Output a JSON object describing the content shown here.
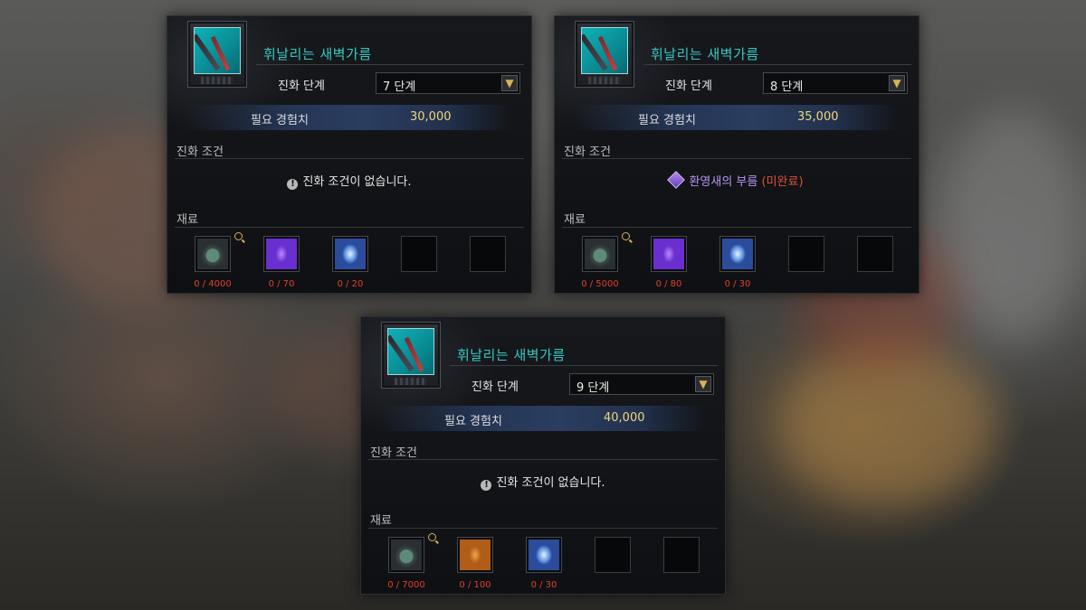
{
  "panels": [
    {
      "item_name": "휘날리는 새벽가름",
      "stage_label": "진화 단계",
      "stage_value": "7 단계",
      "exp_label": "필요 경험치",
      "exp_value": "30,000",
      "conditions_heading": "진화 조건",
      "condition_text": "진화 조건이 없습니다.",
      "materials_heading": "재료",
      "materials": [
        {
          "icon": "chest-icon",
          "qty": "0 / 4000"
        },
        {
          "icon": "purple-crystal-icon",
          "qty": "0 / 70"
        },
        {
          "icon": "blue-shield-gem-icon",
          "qty": "0 / 20"
        }
      ]
    },
    {
      "item_name": "휘날리는 새벽가름",
      "stage_label": "진화 단계",
      "stage_value": "8 단계",
      "exp_label": "필요 경험치",
      "exp_value": "35,000",
      "conditions_heading": "진화 조건",
      "condition_quest": "환영새의 부름",
      "condition_status": "(미완료)",
      "materials_heading": "재료",
      "materials": [
        {
          "icon": "chest-icon",
          "qty": "0 / 5000"
        },
        {
          "icon": "purple-crystal-icon",
          "qty": "0 / 80"
        },
        {
          "icon": "blue-shield-gem-icon",
          "qty": "0 / 30"
        }
      ]
    },
    {
      "item_name": "휘날리는 새벽가름",
      "stage_label": "진화 단계",
      "stage_value": "9 단계",
      "exp_label": "필요 경험치",
      "exp_value": "40,000",
      "conditions_heading": "진화 조건",
      "condition_text": "진화 조건이 없습니다.",
      "materials_heading": "재료",
      "materials": [
        {
          "icon": "chest-icon",
          "qty": "0 / 7000"
        },
        {
          "icon": "amber-stone-icon",
          "qty": "0 / 100"
        },
        {
          "icon": "blue-shield-gem-icon",
          "qty": "0 / 30"
        }
      ]
    }
  ],
  "colors": {
    "title": "#37c9c0",
    "exp_value": "#f0d67a",
    "quantity": "#e2402e",
    "quest": "#b995ef",
    "incomplete": "#e0513f"
  }
}
